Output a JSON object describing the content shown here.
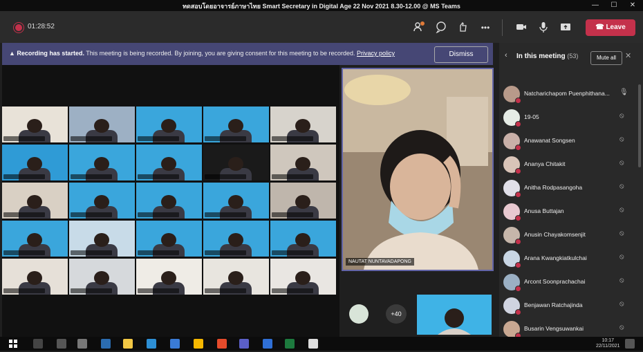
{
  "window": {
    "title": "ทดสอบโดยอาจารย์ภาษาไทย Smart Secretary in Digital Age 22 Nov 2021 8.30-12.00 @ MS Teams",
    "minimize": "—",
    "maximize": "☐",
    "close": "✕"
  },
  "toolbar": {
    "timer": "01:28:52",
    "leave_label": "Leave"
  },
  "banner": {
    "strong": "Recording has started.",
    "text": " This meeting is being recorded. By joining, you are giving consent for this meeting to be recorded.",
    "link": "Privacy policy",
    "dismiss_label": "Dismiss"
  },
  "spotlight": {
    "name": "NAUTAT NUNTAVADAPONG"
  },
  "self_area": {
    "overflow_count": "+40"
  },
  "sidebar": {
    "title": "In this meeting",
    "count": "(53)",
    "mute_all": "Mute all",
    "people": [
      {
        "name": "Natcharichapom Puenphithana..."
      },
      {
        "name": "19-05"
      },
      {
        "name": "Anawanat Songsen"
      },
      {
        "name": "Ananya Chitakit"
      },
      {
        "name": "Anitha Rodpasangoha"
      },
      {
        "name": "Anusa Buttajan"
      },
      {
        "name": "Anusin Chayakomsenjit"
      },
      {
        "name": "Arana Kwangkiatkulchai"
      },
      {
        "name": "Arcont Soonprachachai"
      },
      {
        "name": "Benjawan Ratchajinda"
      },
      {
        "name": "Busarin Vengsuwankai"
      }
    ]
  },
  "taskbar": {
    "time": "10:17",
    "date": "22/11/2021"
  },
  "colors": {
    "accent": "#6264a7",
    "leave": "#c4314b",
    "banner": "#464775"
  }
}
